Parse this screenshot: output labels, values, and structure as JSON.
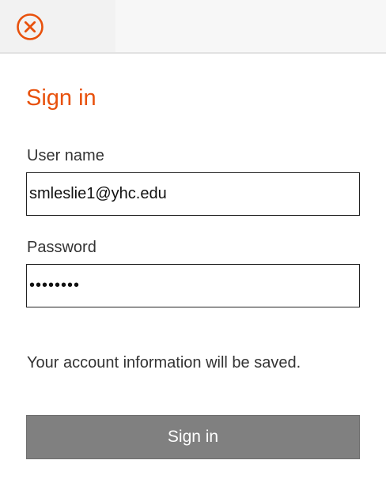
{
  "header": {
    "close_icon": "close-circle-icon",
    "accent_color": "#e8510c"
  },
  "form": {
    "title": "Sign in",
    "username_label": "User name",
    "username_value": "smleslie1@yhc.edu",
    "password_label": "Password",
    "password_value": "••••••••",
    "note": "Your account information will be saved.",
    "submit_label": "Sign in",
    "submit_color": "#808080"
  }
}
